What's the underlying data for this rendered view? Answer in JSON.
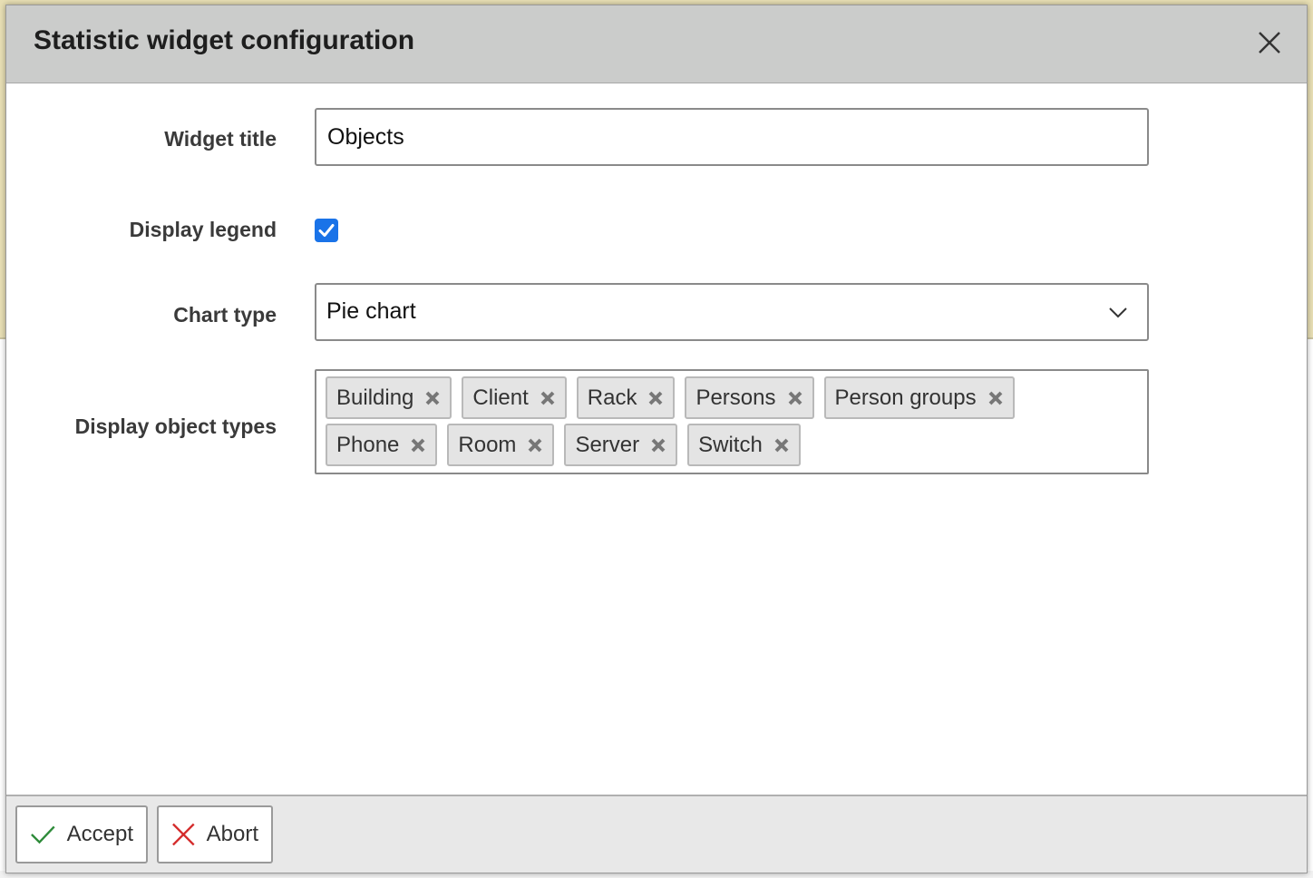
{
  "dialog": {
    "title": "Statistic widget configuration"
  },
  "form": {
    "widget_title": {
      "label": "Widget title",
      "value": "Objects"
    },
    "display_legend": {
      "label": "Display legend",
      "checked": true
    },
    "chart_type": {
      "label": "Chart type",
      "value": "Pie chart"
    },
    "object_types": {
      "label": "Display object types",
      "tags": [
        "Building",
        "Client",
        "Rack",
        "Persons",
        "Person groups",
        "Phone",
        "Room",
        "Server",
        "Switch"
      ]
    }
  },
  "footer": {
    "accept_label": "Accept",
    "abort_label": "Abort"
  },
  "colors": {
    "checkbox": "#1a73e8",
    "accept_icon": "#2e8b3a",
    "abort_icon": "#d42a2a"
  },
  "icons": {
    "close": "close-icon",
    "chevron": "chevron-down-icon",
    "tag_remove": "remove-tag-icon",
    "accept": "checkmark-icon",
    "abort": "cross-icon"
  }
}
